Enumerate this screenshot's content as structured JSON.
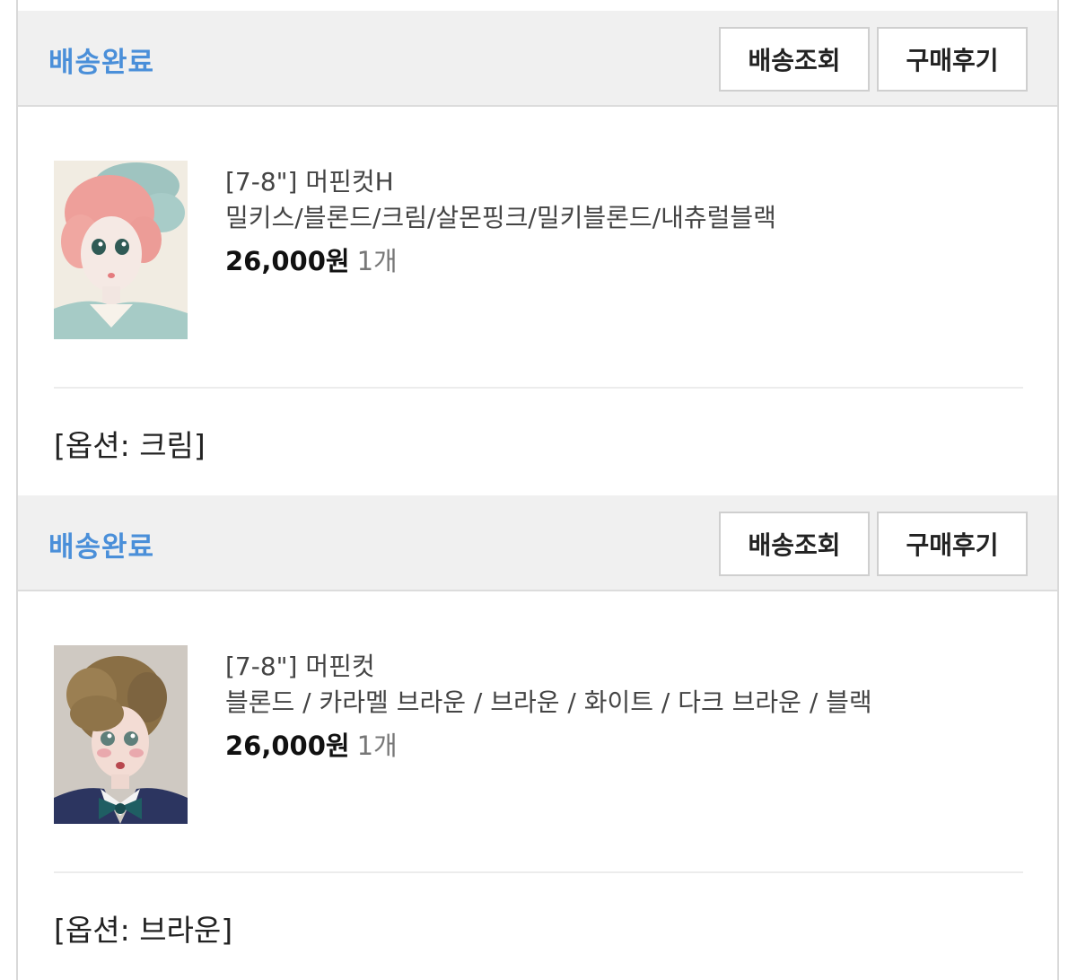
{
  "orders": [
    {
      "status": "배송완료",
      "track_button": "배송조회",
      "review_button": "구매후기",
      "product_name": "[7-8\"] 머핀컷H",
      "variants": "밀키스/블론드/크림/살몬핑크/밀키블론드/내츄럴블랙",
      "price": "26,000원",
      "quantity": "1개",
      "option": "[옵션: 크림]",
      "thumbnail_icon": "doll-pink-wig-image"
    },
    {
      "status": "배송완료",
      "track_button": "배송조회",
      "review_button": "구매후기",
      "product_name": "[7-8\"] 머핀컷",
      "variants": "블론드 / 카라멜 브라운 / 브라운 / 화이트 / 다크 브라운 / 블랙",
      "price": "26,000원",
      "quantity": "1개",
      "option": "[옵션: 브라운]",
      "thumbnail_icon": "doll-brown-wig-image"
    }
  ],
  "colors": {
    "status": "#4a8fd9",
    "header_bg": "#f0f0f0",
    "border": "#d9d9d9"
  }
}
